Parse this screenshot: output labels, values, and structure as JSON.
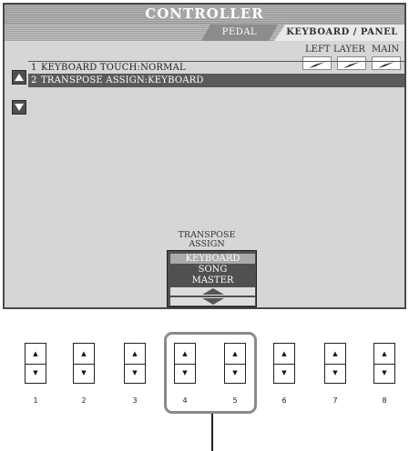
{
  "screen": {
    "title": "CONTROLLER",
    "tabs": [
      {
        "label": "PEDAL",
        "active": false
      },
      {
        "label": "KEYBOARD / PANEL",
        "active": true
      }
    ],
    "column_headers": [
      "LEFT",
      "LAYER",
      "MAIN"
    ],
    "list": [
      {
        "num": "1",
        "label": "KEYBOARD TOUCH:NORMAL",
        "selected": false
      },
      {
        "num": "2",
        "label": "TRANSPOSE ASSIGN:KEYBOARD",
        "selected": true
      }
    ],
    "checkboxes_checked": [
      true,
      true,
      true
    ]
  },
  "transpose_assign": {
    "title_line1": "TRANSPOSE",
    "title_line2": "ASSIGN",
    "options": [
      "KEYBOARD",
      "SONG",
      "MASTER"
    ],
    "selected": "KEYBOARD"
  },
  "buttons": {
    "labels": [
      "1",
      "2",
      "3",
      "4",
      "5",
      "6",
      "7",
      "8"
    ],
    "up_glyph": "▲",
    "down_glyph": "▼",
    "highlighted": [
      "4",
      "5"
    ]
  },
  "colors": {
    "screen_bg": "#d6d6d6",
    "selected_row": "#5b5b5b",
    "selector_bg": "#505050"
  }
}
